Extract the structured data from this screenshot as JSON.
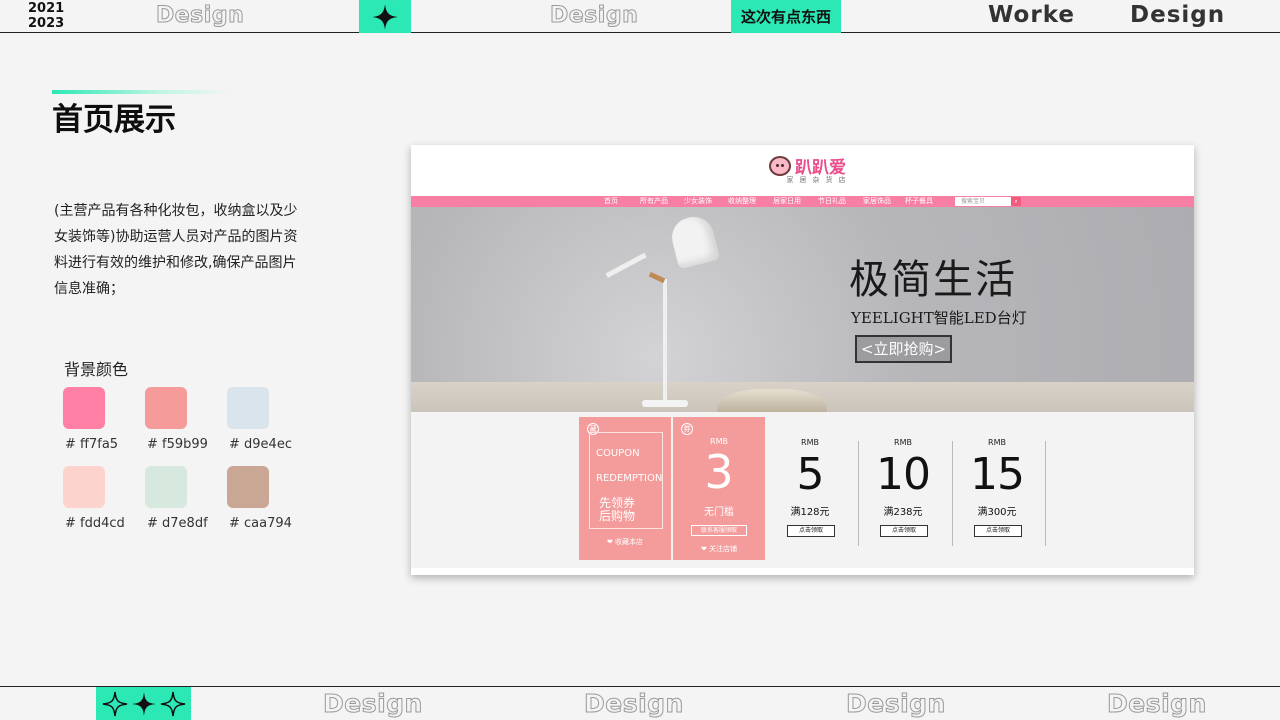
{
  "header": {
    "year_start": "2021",
    "year_end": "2023",
    "design_1": "Design",
    "design_2": "Design",
    "tag": "这次有点东西",
    "brand_1": "Worke",
    "brand_2": "Design",
    "star_icon": "four-point-star-icon"
  },
  "footer": {
    "stars_icon": "three-sparkle-stars-icon",
    "design_labels": [
      "Design",
      "Design",
      "Design",
      "Design"
    ]
  },
  "page": {
    "title": "首页展示",
    "description": "(主营产品有各种化妆包，收纳盒以及少女装饰等)协助运营人员对产品的图片资料进行有效的维护和修改,确保产品图片信息准确；"
  },
  "palette": {
    "title": "背景颜色",
    "colors": [
      {
        "hex": "#ff7fa5",
        "label": "# ff7fa5"
      },
      {
        "hex": "#f59b99",
        "label": "# f59b99"
      },
      {
        "hex": "#d9e4ec",
        "label": "# d9e4ec"
      },
      {
        "hex": "#fdd4cd",
        "label": "# fdd4cd"
      },
      {
        "hex": "#d7e8df",
        "label": "# d7e8df"
      },
      {
        "hex": "#caa794",
        "label": "# caa794"
      }
    ]
  },
  "mockup": {
    "logo_text": "趴趴爱",
    "logo_sub": "家居杂货店",
    "nav_items": [
      "首页",
      "所有产品",
      "少女装饰",
      "收纳整理",
      "居家日用",
      "节日礼品",
      "家居饰品",
      "杯子餐具"
    ],
    "search_placeholder": "搜索宝贝",
    "search_icon": "search-icon",
    "banner": {
      "title": "极简生活",
      "subtitle": "YEELIGHT智能LED台灯",
      "cta": "<立即抢购>"
    },
    "coupon_main": {
      "badge": "藏",
      "line1": "COUPON",
      "line2": "REDEMPTION",
      "line3": "先领券",
      "line4": "后购物",
      "footer": "❤ 收藏本店"
    },
    "coupon_3": {
      "badge": "券",
      "currency": "RMB",
      "amount": "3",
      "condition": "无门槛",
      "button": "联系客服领取",
      "footer": "❤ 关注店铺"
    },
    "vouchers": [
      {
        "currency": "RMB",
        "amount": "5",
        "condition": "满128元",
        "button": "点击领取"
      },
      {
        "currency": "RMB",
        "amount": "10",
        "condition": "满238元",
        "button": "点击领取"
      },
      {
        "currency": "RMB",
        "amount": "15",
        "condition": "满300元",
        "button": "点击领取"
      }
    ]
  }
}
